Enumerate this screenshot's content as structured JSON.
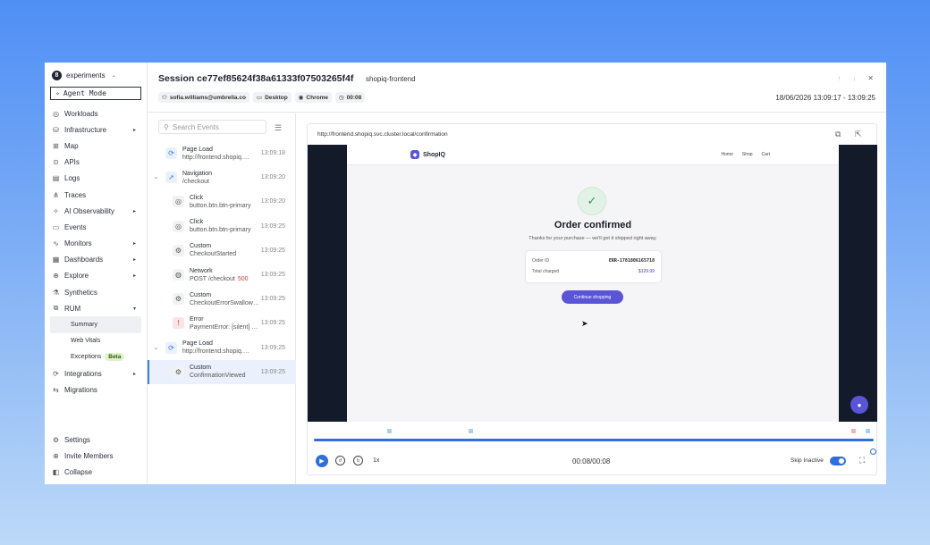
{
  "sidebar": {
    "org": {
      "logo": "8",
      "name": "experiments"
    },
    "agent_mode": "Agent Mode",
    "items": [
      {
        "label": "Workloads",
        "icon": "workloads-icon",
        "glyph": "◎"
      },
      {
        "label": "Infrastructure",
        "icon": "infrastructure-icon",
        "glyph": "⛁",
        "chev": "▸"
      },
      {
        "label": "Map",
        "icon": "map-icon",
        "glyph": "⊞"
      },
      {
        "label": "APIs",
        "icon": "apis-icon",
        "glyph": "⊙"
      },
      {
        "label": "Logs",
        "icon": "logs-icon",
        "glyph": "▤"
      },
      {
        "label": "Traces",
        "icon": "traces-icon",
        "glyph": "⋔"
      },
      {
        "label": "AI Observability",
        "icon": "ai-observability-icon",
        "glyph": "✧",
        "chev": "▸"
      },
      {
        "label": "Events",
        "icon": "events-icon",
        "glyph": "▭"
      },
      {
        "label": "Monitors",
        "icon": "monitors-icon",
        "glyph": "∿",
        "chev": "▸"
      },
      {
        "label": "Dashboards",
        "icon": "dashboards-icon",
        "glyph": "▦",
        "chev": "▸"
      },
      {
        "label": "Explore",
        "icon": "explore-icon",
        "glyph": "⊕",
        "chev": "▸"
      },
      {
        "label": "Synthetics",
        "icon": "synthetics-icon",
        "glyph": "⚗"
      },
      {
        "label": "RUM",
        "icon": "rum-icon",
        "glyph": "⧉",
        "chev": "▾"
      }
    ],
    "rum_sub": [
      {
        "label": "Summary"
      },
      {
        "label": "Web Vitals"
      },
      {
        "label": "Exceptions",
        "badge": "Beta"
      }
    ],
    "items2": [
      {
        "label": "Integrations",
        "icon": "integrations-icon",
        "glyph": "⟳",
        "chev": "▸"
      },
      {
        "label": "Migrations",
        "icon": "migrations-icon",
        "glyph": "⇆"
      }
    ],
    "bottom": [
      {
        "label": "Settings",
        "icon": "settings-icon",
        "glyph": "⚙"
      },
      {
        "label": "Invite Members",
        "icon": "invite-icon",
        "glyph": "⊕"
      },
      {
        "label": "Collapse",
        "icon": "collapse-icon",
        "glyph": "◧"
      }
    ]
  },
  "header": {
    "title": "Session ce77ef85624f38a61333f07503265f4f",
    "service": "shopiq-frontend",
    "chips": [
      {
        "label": "sofia.williams@umbrella.co",
        "icon": "user-icon",
        "glyph": "⚇"
      },
      {
        "label": "Desktop",
        "icon": "desktop-icon",
        "glyph": "▭"
      },
      {
        "label": "Chrome",
        "icon": "chrome-icon",
        "glyph": "◉"
      },
      {
        "label": "00:08",
        "icon": "clock-icon",
        "glyph": "◷"
      }
    ],
    "date_range": "18/06/2026 13:09:17 - 13:09:25"
  },
  "events": {
    "search_placeholder": "Search Events",
    "list": [
      {
        "type": "Page Load",
        "detail": "http://frontend.shopiq.svc.cluster.local/checkout",
        "time": "13:09:18",
        "icon": "page-load-icon",
        "glyph": "⟳",
        "bg": "#e8f1fc",
        "fg": "#3d7be0",
        "indent": 0,
        "caret": ""
      },
      {
        "type": "Navigation",
        "detail": "/checkout",
        "time": "13:09:20",
        "icon": "navigation-icon",
        "glyph": "➚",
        "bg": "#e8f1fc",
        "fg": "#3d7be0",
        "indent": 0,
        "caret": "⌄"
      },
      {
        "type": "Click",
        "detail": "button.btn.btn-primary",
        "time": "13:09:20",
        "icon": "click-icon",
        "glyph": "◎",
        "bg": "#f1f2f5",
        "fg": "#555",
        "indent": 1,
        "caret": ""
      },
      {
        "type": "Click",
        "detail": "button.btn.btn-primary",
        "time": "13:09:25",
        "icon": "click-icon",
        "glyph": "◎",
        "bg": "#f1f2f5",
        "fg": "#555",
        "indent": 1,
        "caret": ""
      },
      {
        "type": "Custom",
        "detail": "CheckoutStarted",
        "time": "13:09:25",
        "icon": "custom-icon",
        "glyph": "⚙",
        "bg": "#f1f2f5",
        "fg": "#555",
        "indent": 1,
        "caret": ""
      },
      {
        "type": "Network",
        "detail": "POST /checkout",
        "status": "500",
        "time": "13:09:25",
        "icon": "network-icon",
        "glyph": "◍",
        "bg": "#f1f2f5",
        "fg": "#555",
        "indent": 1,
        "caret": ""
      },
      {
        "type": "Custom",
        "detail": "CheckoutErrorSwallowed",
        "time": "13:09:25",
        "icon": "custom-icon",
        "glyph": "⚙",
        "bg": "#f1f2f5",
        "fg": "#555",
        "indent": 1,
        "caret": ""
      },
      {
        "type": "Error",
        "detail": "PaymentError: [silent] payment failed",
        "time": "13:09:25",
        "icon": "error-icon",
        "glyph": "!",
        "bg": "#fde3e3",
        "fg": "#d83a3a",
        "indent": 1,
        "caret": ""
      },
      {
        "type": "Page Load",
        "detail": "http://frontend.shopiq.svc.cluster.local/confirmation",
        "time": "13:09:25",
        "icon": "page-load-icon",
        "glyph": "⟳",
        "bg": "#e8f1fc",
        "fg": "#3d7be0",
        "indent": 0,
        "caret": "⌄"
      },
      {
        "type": "Custom",
        "detail": "ConfirmationViewed",
        "time": "13:09:25",
        "icon": "custom-icon",
        "glyph": "⚙",
        "bg": "#f1f2f5",
        "fg": "#555",
        "indent": 1,
        "caret": "",
        "selected": true
      }
    ]
  },
  "player": {
    "url": "http://frontend.shopiq.svc.cluster.local/confirmation",
    "site": {
      "brand": "ShopIQ",
      "nav": [
        "Home",
        "Shop",
        "Cart"
      ],
      "heading": "Order confirmed",
      "subtext": "Thanks for your purchase — we'll get it shipped right away.",
      "order_id_label": "Order ID",
      "order_id": "ERR-1781806165718",
      "total_label": "Total charged",
      "total": "$129.99",
      "button": "Continue shopping"
    },
    "speed": "1x",
    "time": "00:08/00:08",
    "progress": 1.0,
    "skip_inactive_label": "Skip Inactive",
    "skip_inactive": true,
    "accent": "#2f6fd9",
    "brand_color": "#5a55d6"
  }
}
